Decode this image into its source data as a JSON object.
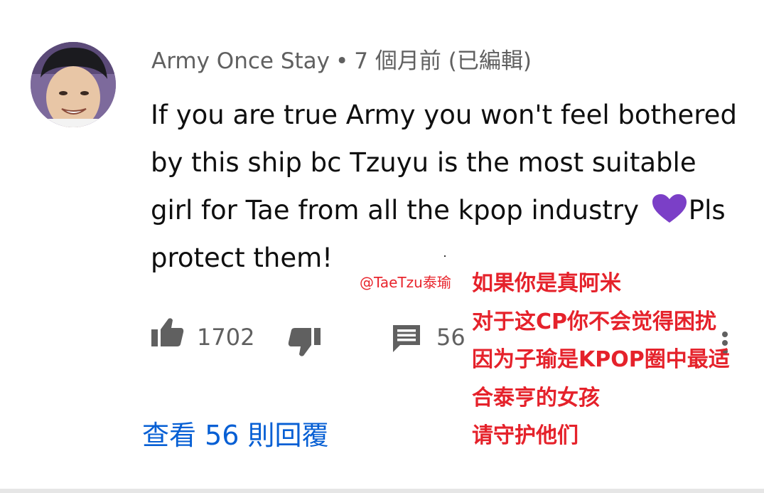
{
  "comment": {
    "author": "Army Once Stay",
    "separator": "•",
    "posted": "7 個月前 (已編輯)",
    "text_lines": [
      "If you are true Army you won't feel bothered",
      "by this ship bc Tzuyu is the most suitable",
      "girl for Tae from all the kpop industry ",
      "protect them!"
    ],
    "line3_after_heart": "Pls",
    "heart_color": "#7b3fc7",
    "like_count": "1702",
    "reply_count": "56",
    "view_replies": "查看 56 則回覆"
  },
  "overlay": {
    "handle": "@TaeTzu泰瑜",
    "lines": [
      "如果你是真阿米",
      "对于这CP你不会觉得困扰",
      "因为子瑜是KPOP圈中最适",
      "合泰亨的女孩",
      "请守护他们"
    ],
    "color": "#e5222b"
  },
  "icons": {
    "like": "thumbs-up-icon",
    "dislike": "thumbs-down-icon",
    "reply": "comment-icon",
    "more": "more-vertical-icon",
    "heart": "purple-heart-icon"
  }
}
